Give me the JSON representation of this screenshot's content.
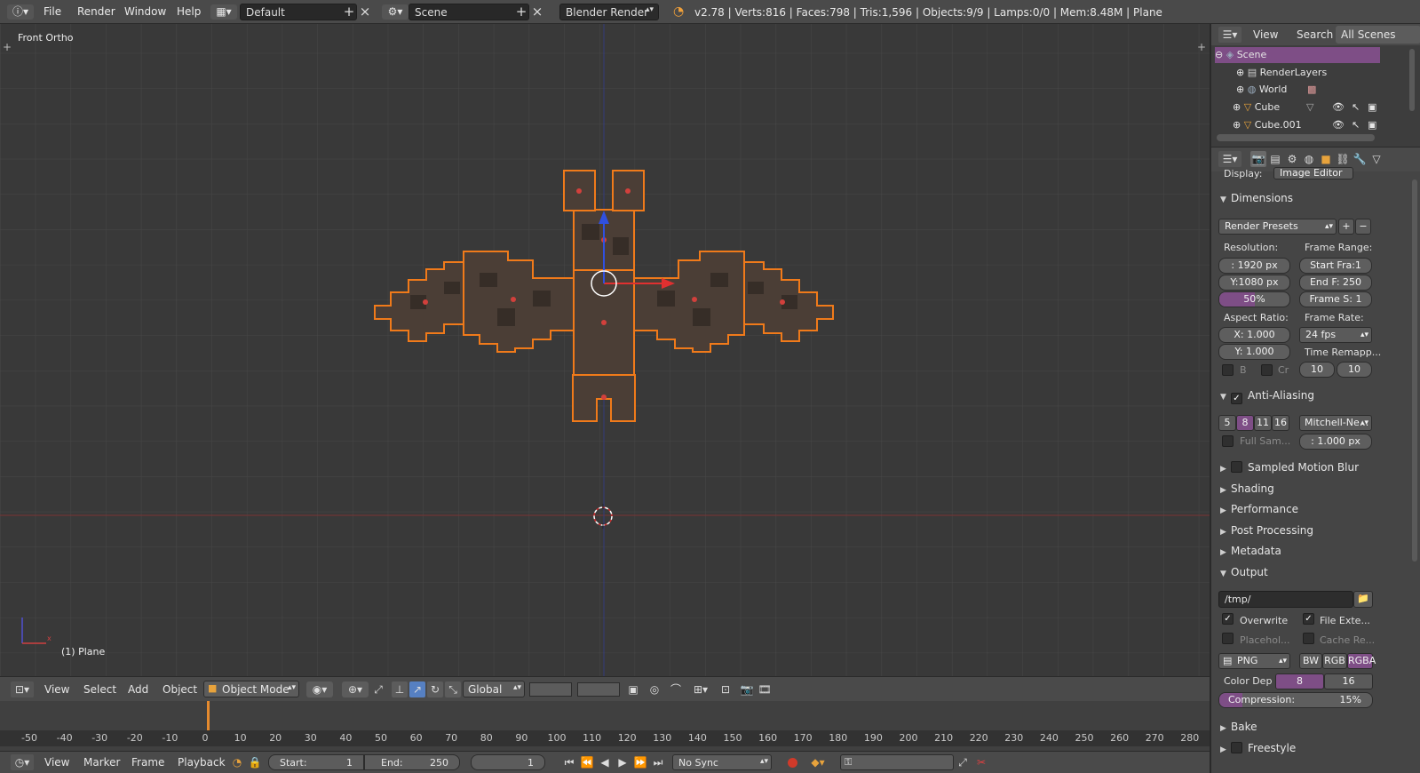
{
  "topbar": {
    "menus": [
      "File",
      "Render",
      "Window",
      "Help"
    ],
    "layout": "Default",
    "scene": "Scene",
    "engine": "Blender Render",
    "stats": "v2.78 | Verts:816 | Faces:798 | Tris:1,596 | Objects:9/9 | Lamps:0/0 | Mem:8.48M | Plane"
  },
  "viewport": {
    "view_label": "Front Ortho",
    "object_label": "(1) Plane"
  },
  "vp_header": {
    "menus": [
      "View",
      "Select",
      "Add",
      "Object"
    ],
    "mode": "Object Mode",
    "orientation": "Global"
  },
  "timeline": {
    "ticks": [
      "-50",
      "-40",
      "-30",
      "-20",
      "-10",
      "0",
      "10",
      "20",
      "30",
      "40",
      "50",
      "60",
      "70",
      "80",
      "90",
      "100",
      "110",
      "120",
      "130",
      "140",
      "150",
      "160",
      "170",
      "180",
      "190",
      "200",
      "210",
      "220",
      "230",
      "240",
      "250",
      "260",
      "270",
      "280"
    ],
    "menus": [
      "View",
      "Marker",
      "Frame",
      "Playback"
    ],
    "start_label": "Start:",
    "start_value": "1",
    "end_label": "End:",
    "end_value": "250",
    "current_frame": "1",
    "sync": "No Sync"
  },
  "outliner": {
    "menus": [
      "View",
      "Search",
      "All Scenes"
    ],
    "items": [
      "Scene",
      "RenderLayers",
      "World",
      "Cube",
      "Cube.001"
    ]
  },
  "properties": {
    "display_label": "Display:",
    "display_value": "Image Editor",
    "dimensions": {
      "title": "Dimensions",
      "presets": "Render Presets",
      "resolution_label": "Resolution:",
      "res_x": ": 1920 px",
      "res_y": "Y:1080 px",
      "res_pct": "50%",
      "frame_range_label": "Frame Range:",
      "start_frame": "Start Fra:1",
      "end_frame": "End F: 250",
      "frame_step": "Frame S: 1",
      "aspect_label": "Aspect Ratio:",
      "aspect_x": "X:   1.000",
      "aspect_y": "Y:   1.000",
      "frame_rate_label": "Frame Rate:",
      "frame_rate": "24 fps",
      "time_remap_label": "Time Remapp...",
      "border_label": "B",
      "crop_label": "Cr",
      "remap_old": "10",
      "remap_new": "10"
    },
    "aa": {
      "title": "Anti-Aliasing",
      "samples": [
        "5",
        "8",
        "11",
        "16"
      ],
      "filter": "Mitchell-Ne...",
      "full_sample": "Full Sam...",
      "filter_size": ": 1.000 px"
    },
    "collapsed": [
      "Sampled Motion Blur",
      "Shading",
      "Performance",
      "Post Processing",
      "Metadata"
    ],
    "output": {
      "title": "Output",
      "path": "/tmp/",
      "overwrite": "Overwrite",
      "file_ext": "File Exte...",
      "placeholders": "Placehol...",
      "cache": "Cache Re...",
      "format": "PNG",
      "bw": "BW",
      "rgb": "RGB",
      "rgba": "RGBA",
      "color_depth_label": "Color Dep",
      "depth_8": "8",
      "depth_16": "16",
      "compression_label": "Compression:",
      "compression_value": "15%",
      "compression_level": 0.15
    },
    "bottom": [
      "Bake",
      "Freestyle"
    ]
  },
  "colors": {
    "accent": "#e58a2e",
    "selection_orange": "#f07a1a",
    "purple": "#7e4e86",
    "x_axis": "#b13b3b",
    "z_axis": "#3552c4"
  }
}
